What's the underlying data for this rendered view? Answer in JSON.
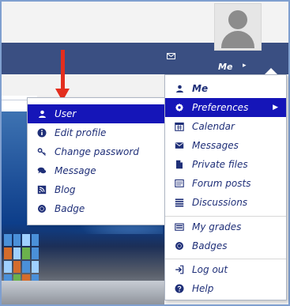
{
  "header": {
    "user_label": "Me"
  },
  "left_menu": {
    "items": [
      {
        "label": "User",
        "icon": "user-icon"
      },
      {
        "label": "Edit profile",
        "icon": "info-icon"
      },
      {
        "label": "Change password",
        "icon": "key-icon"
      },
      {
        "label": "Message",
        "icon": "message-icon"
      },
      {
        "label": "Blog",
        "icon": "blog-icon"
      },
      {
        "label": "Badge",
        "icon": "badge-icon"
      }
    ],
    "active_index": 0
  },
  "right_menu": {
    "items": [
      {
        "label": "Me",
        "icon": "user-icon"
      },
      {
        "label": "Preferences",
        "icon": "gear-icon"
      },
      {
        "label": "Calendar",
        "icon": "calendar-icon"
      },
      {
        "label": "Messages",
        "icon": "envelope-icon"
      },
      {
        "label": "Private files",
        "icon": "file-icon"
      },
      {
        "label": "Forum posts",
        "icon": "forum-icon"
      },
      {
        "label": "Discussions",
        "icon": "list-icon"
      },
      {
        "label": "My grades",
        "icon": "grades-icon"
      },
      {
        "label": "Badges",
        "icon": "badge-icon"
      },
      {
        "label": "Log out",
        "icon": "logout-icon"
      },
      {
        "label": "Help",
        "icon": "help-icon"
      }
    ],
    "active_index": 1
  },
  "colors": {
    "navbar": "#3a4f82",
    "menu_text": "#1f2f78",
    "active_background": "#1515b8",
    "arrow": "#e32e1e"
  }
}
